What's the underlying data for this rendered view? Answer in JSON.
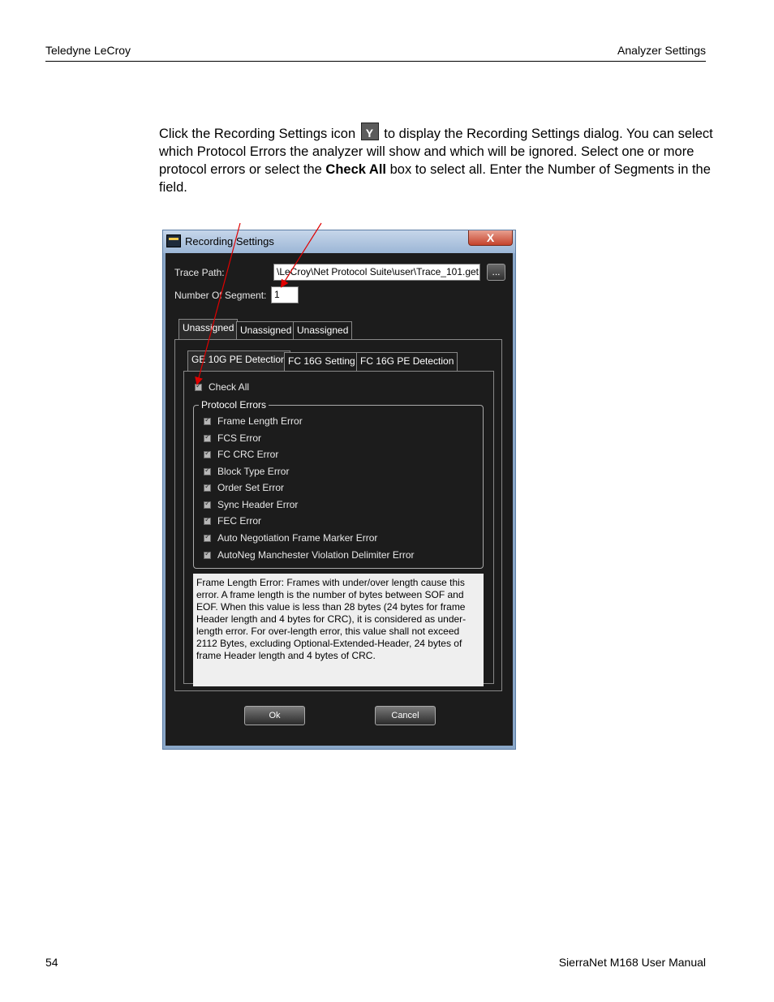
{
  "header": {
    "left": "Teledyne LeCroy",
    "right": "Analyzer Settings"
  },
  "body": {
    "p1": "Click the Recording Settings icon",
    "p2": " to display the Recording Settings dialog. You can select which Protocol Errors the analyzer will show and which will be ignored. Select one or more protocol errors or select the ",
    "bold": "Check All",
    "p3": " box to select all. Enter the Number of Segments in the field."
  },
  "dialog": {
    "title": "Recording Settings",
    "close": "X",
    "trace_path_label": "Trace Path:",
    "trace_path_value": "\\LeCroy\\Net Protocol Suite\\user\\Trace_101.get",
    "browse": "...",
    "segments_label": "Number Of Segment:",
    "segments_value": "1",
    "outer_tabs": [
      "Unassigned",
      "Unassigned",
      "Unassigned"
    ],
    "inner_tabs": [
      "GE 10G PE Detection",
      "FC 16G Setting",
      "FC 16G PE Detection"
    ],
    "check_all": "Check All",
    "group_title": "Protocol Errors",
    "errors": [
      "Frame Length Error",
      "FCS Error",
      "FC CRC Error",
      "Block Type Error",
      "Order Set Error",
      "Sync Header Error",
      "FEC Error",
      "Auto Negotiation Frame Marker Error",
      "AutoNeg Manchester Violation Delimiter Error"
    ],
    "description": "Frame Length Error: Frames with under/over length cause this error. A frame length is the number of bytes between SOF and EOF. When this value is less than 28 bytes (24 bytes for frame Header length and 4 bytes for CRC), it is considered as under-length error. For over-length error, this value shall not exceed 2112 Bytes, excluding Optional-Extended-Header, 24 bytes of frame Header length and 4 bytes of CRC.",
    "ok": "Ok",
    "cancel": "Cancel"
  },
  "footer": {
    "left": "54",
    "right": "SierraNet M168 User Manual"
  }
}
